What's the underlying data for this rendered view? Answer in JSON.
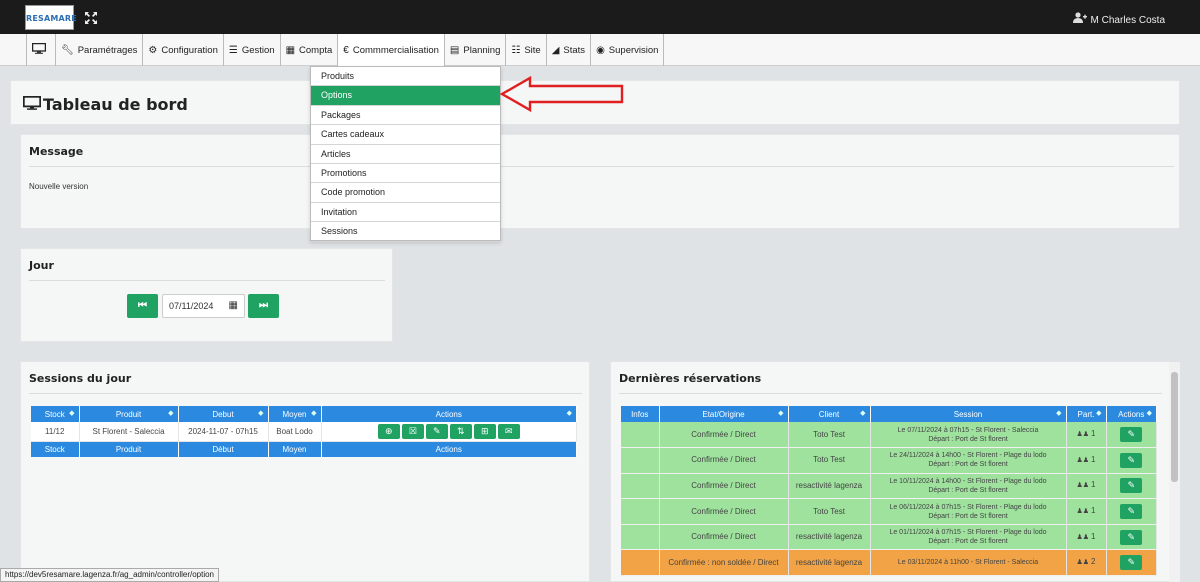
{
  "app": {
    "logo_text": "RESAMARE",
    "user_name": "M Charles Costa"
  },
  "nav": {
    "items": [
      {
        "label": "",
        "icon": "monitor-icon"
      },
      {
        "label": "Paramétrages",
        "icon": "wrench-icon"
      },
      {
        "label": "Configuration",
        "icon": "gears-icon"
      },
      {
        "label": "Gestion",
        "icon": "list-icon"
      },
      {
        "label": "Compta",
        "icon": "calculator-icon"
      },
      {
        "label": "Commmercialisation",
        "icon": "euro-icon"
      },
      {
        "label": "Planning",
        "icon": "calendar-icon"
      },
      {
        "label": "Site",
        "icon": "sitemap-icon"
      },
      {
        "label": "Stats",
        "icon": "area-chart-icon"
      },
      {
        "label": "Supervision",
        "icon": "eye-icon"
      }
    ]
  },
  "dropdown": {
    "items": [
      "Produits",
      "Options",
      "Packages",
      "Cartes cadeaux",
      "Articles",
      "Promotions",
      "Code promotion",
      "Invitation",
      "Sessions"
    ],
    "selected": "Options"
  },
  "dashboard": {
    "title": "Tableau de bord"
  },
  "message": {
    "title": "Message",
    "text": "Nouvelle version"
  },
  "jour": {
    "title": "Jour",
    "date_value": "07/11/2024",
    "prev_icon": "fast-backward-icon",
    "next_icon": "fast-forward-icon"
  },
  "sessions": {
    "title": "Sessions du jour",
    "headers": [
      "Stock",
      "Produit",
      "Debut",
      "Moyen",
      "Actions"
    ],
    "footer": [
      "Stock",
      "Produit",
      "Début",
      "Moyen",
      "Actions"
    ],
    "rows": [
      {
        "stock": "11/12",
        "produit": "St Florent - Saleccia",
        "debut": "2024-11-07 - 07h15",
        "moyen": "Boat Lodo"
      }
    ],
    "action_icons": [
      "plus-circle-icon",
      "calendar-x-icon",
      "edit-icon",
      "sort-icon",
      "calendar-plus-icon",
      "envelope-icon"
    ]
  },
  "reservations": {
    "title": "Dernières réservations",
    "headers": [
      "Infos",
      "Etat/Origine",
      "Client",
      "Session",
      "Part.",
      "Actions"
    ],
    "rows": [
      {
        "status": "green",
        "etat": "Confirmée / Direct",
        "client": "Toto Test",
        "session1": "Le 07/11/2024 à 07h15 - St Florent - Saleccia",
        "session2": "Départ : Port de St florent",
        "part": "1"
      },
      {
        "status": "green",
        "etat": "Confirmée / Direct",
        "client": "Toto Test",
        "session1": "Le 24/11/2024 à 14h00 - St Florent - Plage du lodo",
        "session2": "Départ : Port de St florent",
        "part": "1"
      },
      {
        "status": "green",
        "etat": "Confirmée / Direct",
        "client": "resactivité lagenza",
        "session1": "Le 10/11/2024 à 14h00 - St Florent - Plage du lodo",
        "session2": "Départ : Port de St florent",
        "part": "1"
      },
      {
        "status": "green",
        "etat": "Confirmée / Direct",
        "client": "Toto Test",
        "session1": "Le 06/11/2024 à 07h15 - St Florent - Plage du lodo",
        "session2": "Départ : Port de St florent",
        "part": "1"
      },
      {
        "status": "green",
        "etat": "Confirmée / Direct",
        "client": "resactivité lagenza",
        "session1": "Le 01/11/2024 à 07h15 - St Florent - Plage du lodo",
        "session2": "Départ : Port de St florent",
        "part": "1"
      },
      {
        "status": "orange",
        "etat": "Confirmée : non soldée / Direct",
        "client": "resactivité lagenza",
        "session1": "Le 03/11/2024 à 11h00 - St Florent - Saleccia",
        "session2": "",
        "part": "2"
      }
    ]
  },
  "colors": {
    "accent_green": "#1fa262",
    "header_blue": "#2b8ae0",
    "row_green": "#9ee29e",
    "row_orange": "#f2a345",
    "arrow_red": "#e02020"
  },
  "statusbar": {
    "url": "https://dev5resamare.lagenza.fr/ag_admin/controller/option"
  }
}
